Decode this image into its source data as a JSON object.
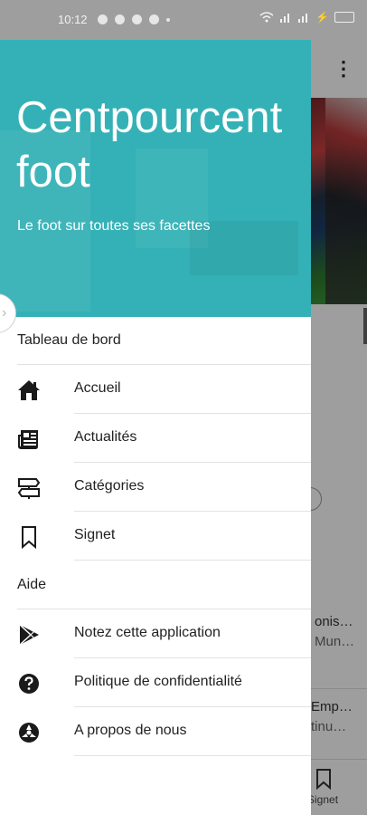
{
  "status_bar": {
    "time": "10:12"
  },
  "background": {
    "snippet1_line1": "onis…",
    "snippet1_line2": "Mun…",
    "snippet2_line1": "Emp…",
    "snippet2_line2": "tinu…",
    "bottom_nav_label": "Signet"
  },
  "drawer": {
    "title": "Centpourcent foot",
    "subtitle": "Le foot sur toutes ses facettes",
    "section1": "Tableau de bord",
    "section2": "Aide",
    "items": [
      {
        "label": "Accueil",
        "icon": "home-icon"
      },
      {
        "label": "Actualités",
        "icon": "newspaper-icon"
      },
      {
        "label": "Catégories",
        "icon": "signpost-icon"
      },
      {
        "label": "Signet",
        "icon": "bookmark-icon"
      },
      {
        "label": "Notez cette application",
        "icon": "play-store-icon"
      },
      {
        "label": "Politique de confidentialité",
        "icon": "help-circle-icon"
      },
      {
        "label": "A propos de nous",
        "icon": "info-badge-icon"
      }
    ],
    "header_color": "#34b1b6"
  }
}
